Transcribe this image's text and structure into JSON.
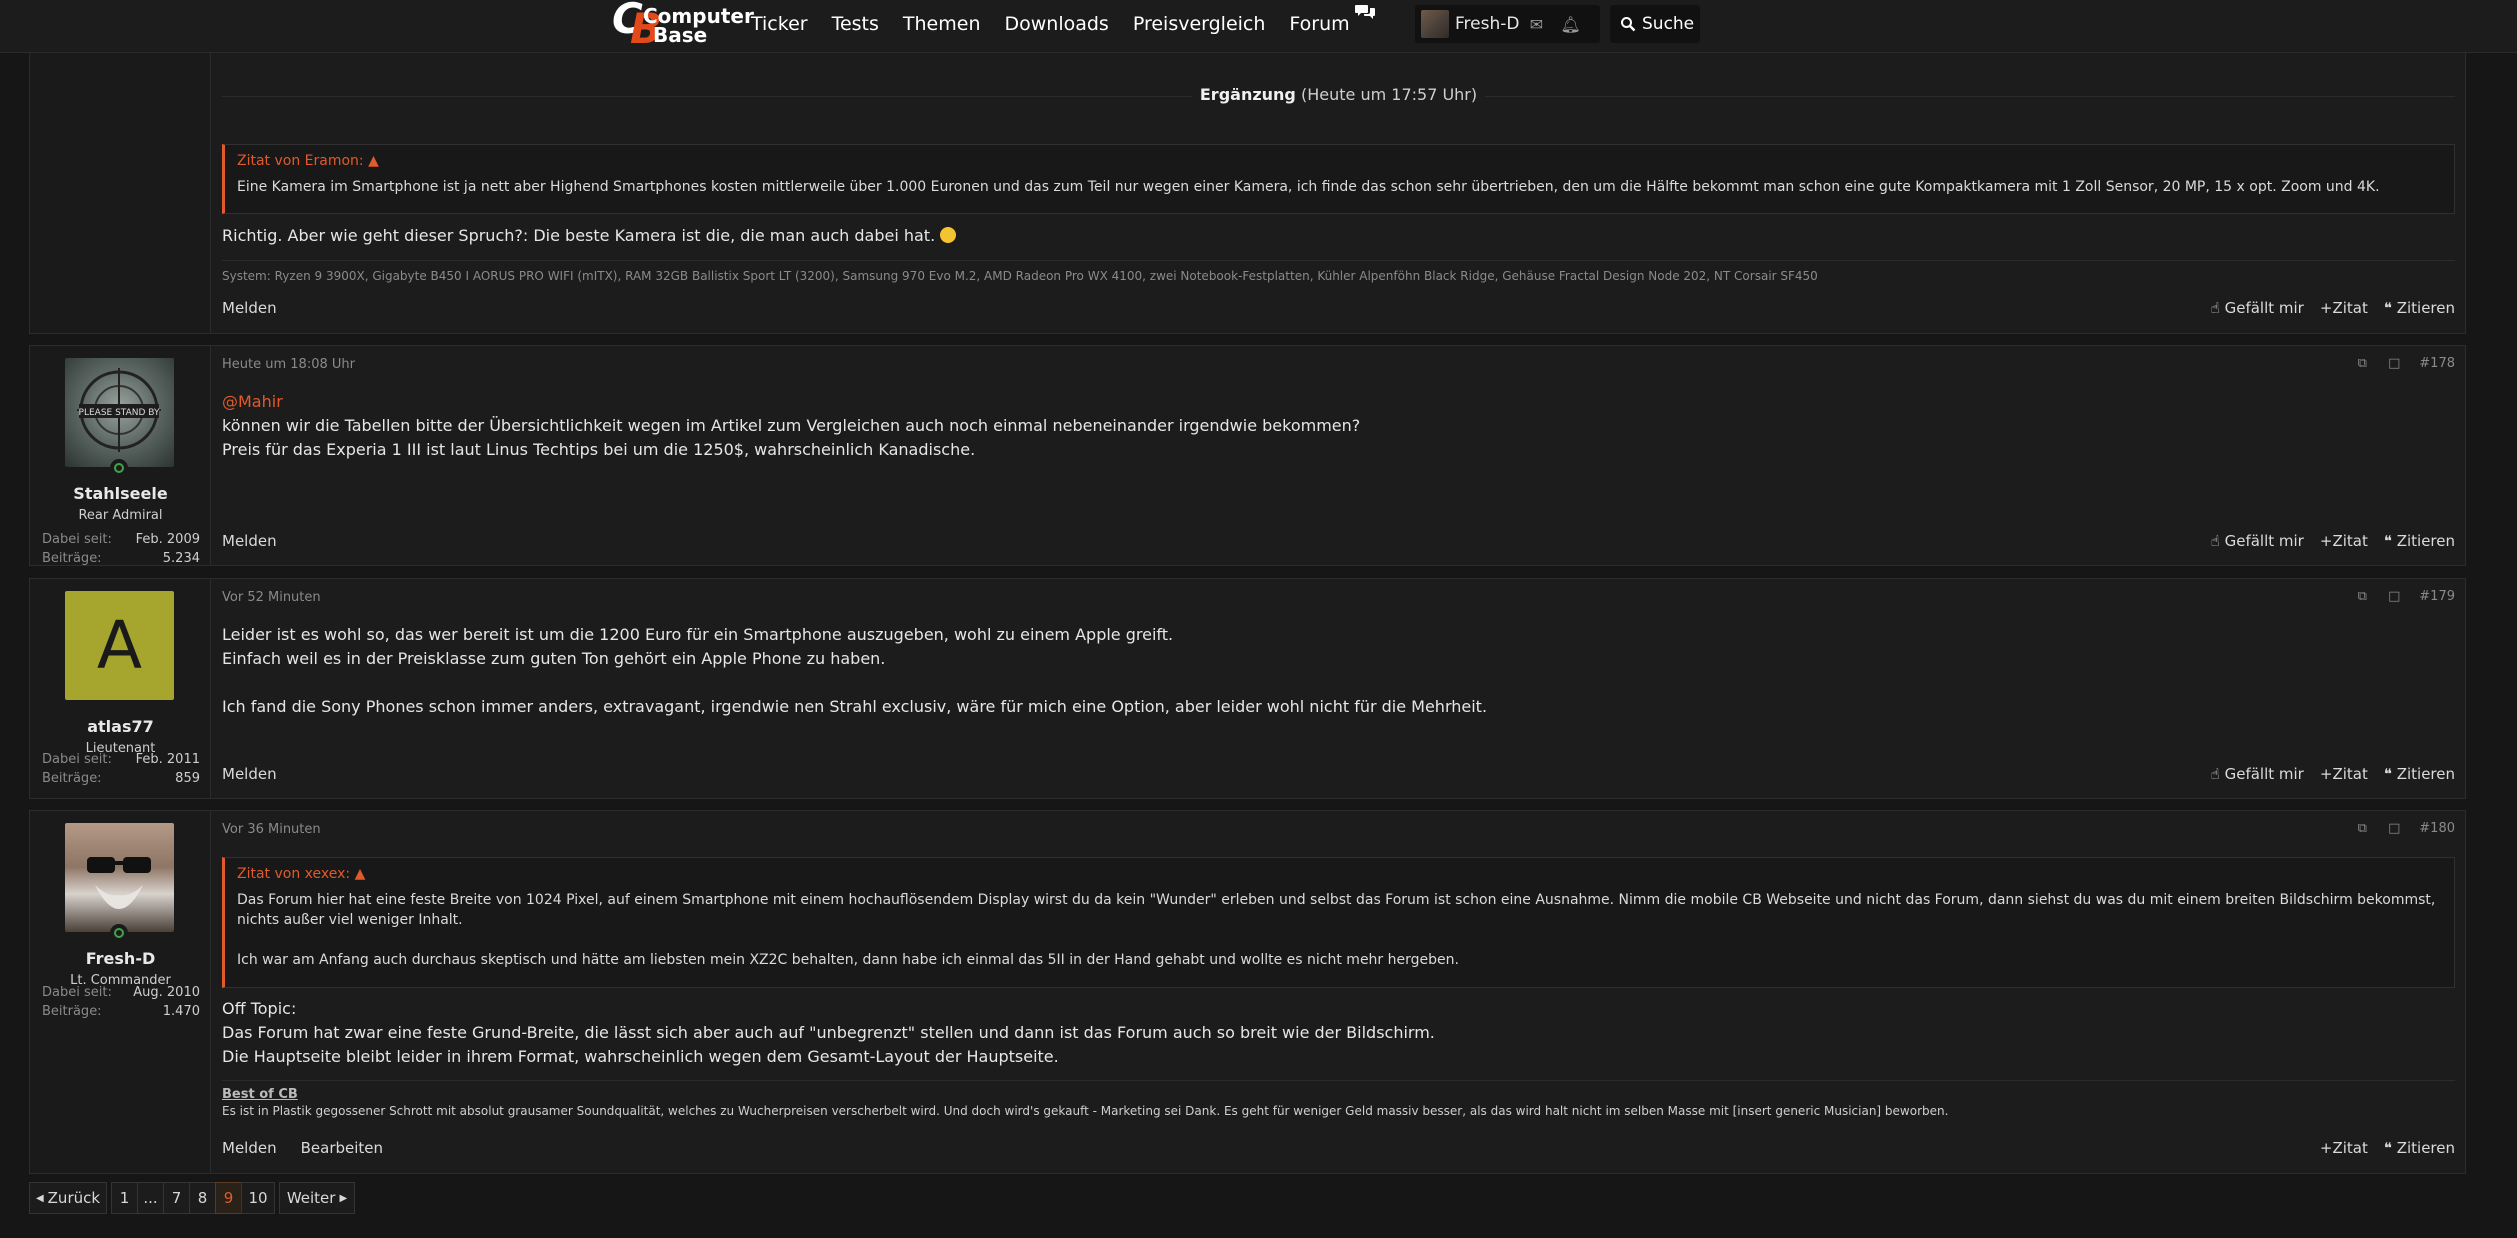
{
  "header": {
    "logo_top": "Computer",
    "logo_bottom": "Base",
    "nav": [
      "Ticker",
      "Tests",
      "Themen",
      "Downloads",
      "Preisvergleich",
      "Forum"
    ],
    "user_name": "Fresh-D",
    "search_label": "Suche"
  },
  "post177": {
    "ergaenzung_label": "Ergänzung",
    "ergaenzung_time": "(Heute um 17:57 Uhr)",
    "quote_header": "Zitat von Eramon:",
    "quote_text": "Eine Kamera im Smartphone ist ja nett aber Highend Smartphones kosten mittlerweile über 1.000 Euronen und das zum Teil nur wegen einer Kamera, ich finde das schon sehr übertrieben, den um die Hälfte bekommt man schon eine gute Kompaktkamera mit 1 Zoll Sensor, 20 MP, 15 x opt. Zoom und 4K.",
    "text": "Richtig. Aber wie geht dieser Spruch?: Die beste Kamera ist die, die man auch dabei hat.",
    "system": "System: Ryzen 9 3900X, Gigabyte B450 I AORUS PRO WIFI (mITX), RAM 32GB Ballistix Sport LT (3200), Samsung 970 Evo M.2, AMD Radeon Pro WX 4100, zwei Notebook-Festplatten, Kühler Alpenföhn Black Ridge, Gehäuse Fractal Design Node 202, NT Corsair SF450"
  },
  "post178": {
    "time": "Heute um 18:08 Uhr",
    "number": "#178",
    "user": "Stahlseele",
    "rank": "Rear Admiral",
    "since_label": "Dabei seit:",
    "since": "Feb. 2009",
    "posts_label": "Beiträge:",
    "posts": "5.234",
    "mention": "@Mahir",
    "line1": "können wir die Tabellen bitte der Übersichtlichkeit wegen im Artikel zum Vergleichen auch noch einmal nebeneinander irgendwie bekommen?",
    "line2": "Preis für das Experia 1 III ist laut Linus Techtips bei um die 1250$, wahrscheinlich Kanadische."
  },
  "post179": {
    "time": "Vor 52 Minuten",
    "number": "#179",
    "user": "atlas77",
    "avatar_letter": "A",
    "rank": "Lieutenant",
    "since_label": "Dabei seit:",
    "since": "Feb. 2011",
    "posts_label": "Beiträge:",
    "posts": "859",
    "line1": "Leider ist es wohl so, das wer bereit ist um die 1200 Euro für ein Smartphone auszugeben, wohl zu einem Apple greift.",
    "line2": "Einfach weil es in der Preisklasse zum guten Ton gehört ein Apple Phone zu haben.",
    "line3": "Ich fand die Sony Phones schon immer anders, extravagant, irgendwie nen Strahl exclusiv, wäre für mich eine Option, aber leider wohl nicht für die Mehrheit."
  },
  "post180": {
    "time": "Vor 36 Minuten",
    "number": "#180",
    "user": "Fresh-D",
    "rank": "Lt. Commander",
    "since_label": "Dabei seit:",
    "since": "Aug. 2010",
    "posts_label": "Beiträge:",
    "posts": "1.470",
    "quote_header": "Zitat von xexex:",
    "quote_p1": "Das Forum hier hat eine feste Breite von 1024 Pixel, auf einem Smartphone mit einem hochauflösendem Display wirst du da kein \"Wunder\" erleben und selbst das Forum ist schon eine Ausnahme. Nimm die mobile CB Webseite und nicht das Forum, dann siehst du was du mit einem breiten Bildschirm bekommst, nichts außer viel weniger Inhalt.",
    "quote_p2": "Ich war am Anfang auch durchaus skeptisch und hätte am liebsten mein XZ2C behalten, dann habe ich einmal das 5II in der Hand gehabt und wollte es nicht mehr hergeben.",
    "line1": "Off Topic:",
    "line2": "Das Forum hat zwar eine feste Grund-Breite, die lässt sich aber auch auf \"unbegrenzt\" stellen und dann ist das Forum auch so breit wie der Bildschirm.",
    "line3": "Die Hauptseite bleibt leider in ihrem Format, wahrscheinlich wegen dem Gesamt-Layout der Hauptseite.",
    "sig_link": "Best of CB",
    "sig_text": "Es ist in Plastik gegossener Schrott mit absolut grausamer Soundqualität, welches zu Wucherpreisen verscherbelt wird. Und doch wird's gekauft - Marketing sei Dank. Es geht für weniger Geld massiv besser, als das wird halt nicht im selben Masse mit [insert generic Musician] beworben.",
    "edit": "Bearbeiten"
  },
  "actions": {
    "report": "Melden",
    "like": "Gefällt mir",
    "quote": "Zitat",
    "cite": "Zitieren"
  },
  "pagination": {
    "prev": "Zurück",
    "pages": [
      "1",
      "...",
      "7",
      "8",
      "9",
      "10"
    ],
    "current": "9",
    "next": "Weiter"
  },
  "colors": {
    "accent": "#e05a2b",
    "background": "#161616",
    "post_bg": "#1c1c1c",
    "online": "#3fa34d",
    "avatar_atlas": "#a6a52e"
  }
}
